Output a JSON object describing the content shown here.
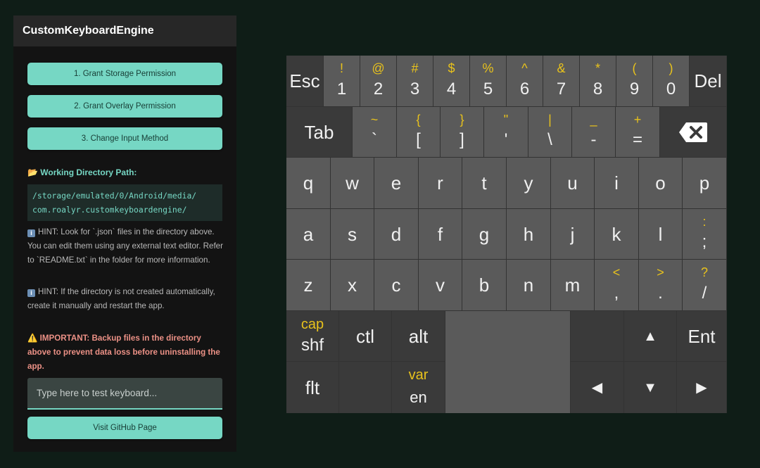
{
  "app": {
    "title": "CustomKeyboardEngine"
  },
  "buttons": {
    "storage": "1. Grant Storage Permission",
    "overlay": "2. Grant Overlay Permission",
    "input_method": "3. Change Input Method",
    "github": "Visit GitHub Page"
  },
  "directory": {
    "label": "📂 Working Directory Path:",
    "path_line1": "/storage/emulated/0/Android/media/",
    "path_line2": "com.roalyr.customkeyboardengine/"
  },
  "hints": {
    "hint1": "HINT: Look for `.json` files in the directory above. You can edit them using any external text editor. Refer to `README.txt` in the folder for more information.",
    "hint2": "HINT: If the directory is not created automatically, create it manually and restart the app.",
    "important": "⚠️ IMPORTANT: Backup files in the directory above to prevent data loss before uninstalling the app."
  },
  "test_input": {
    "placeholder": "Type here to test keyboard..."
  },
  "colors": {
    "accent": "#76d7c4",
    "keyboard_symbol": "#e8c21c",
    "important": "#ec9186"
  },
  "keyboard": {
    "row1": {
      "esc": "Esc",
      "del": "Del",
      "keys": [
        {
          "sup": "!",
          "main": "1"
        },
        {
          "sup": "@",
          "main": "2"
        },
        {
          "sup": "#",
          "main": "3"
        },
        {
          "sup": "$",
          "main": "4"
        },
        {
          "sup": "%",
          "main": "5"
        },
        {
          "sup": "^",
          "main": "6"
        },
        {
          "sup": "&",
          "main": "7"
        },
        {
          "sup": "*",
          "main": "8"
        },
        {
          "sup": "(",
          "main": "9"
        },
        {
          "sup": ")",
          "main": "0"
        }
      ]
    },
    "row2": {
      "tab": "Tab",
      "backspace_icon": "backspace-icon",
      "keys": [
        {
          "sup": "~",
          "main": "`"
        },
        {
          "sup": "{",
          "main": "["
        },
        {
          "sup": "}",
          "main": "]"
        },
        {
          "sup": "\"",
          "main": "'"
        },
        {
          "sup": "|",
          "main": "\\"
        },
        {
          "sup": "_",
          "main": "-"
        },
        {
          "sup": "+",
          "main": "="
        }
      ]
    },
    "row3": [
      "q",
      "w",
      "e",
      "r",
      "t",
      "y",
      "u",
      "i",
      "o",
      "p"
    ],
    "row4": {
      "letters": [
        "a",
        "s",
        "d",
        "f",
        "g",
        "h",
        "j",
        "k",
        "l"
      ],
      "last": {
        "sup": ":",
        "main": ";"
      }
    },
    "row5": {
      "letters": [
        "z",
        "x",
        "c",
        "v",
        "b",
        "n",
        "m"
      ],
      "symbols": [
        {
          "sup": "<",
          "main": ","
        },
        {
          "sup": ">",
          "main": "."
        },
        {
          "sup": "?",
          "main": "/"
        }
      ]
    },
    "row6": {
      "cap": "cap",
      "shf": "shf",
      "ctl": "ctl",
      "alt": "alt",
      "up": "▲",
      "ent": "Ent"
    },
    "row7": {
      "flt": "flt",
      "var": "var",
      "en": "en",
      "left": "◀",
      "down": "▼",
      "right": "▶"
    }
  }
}
